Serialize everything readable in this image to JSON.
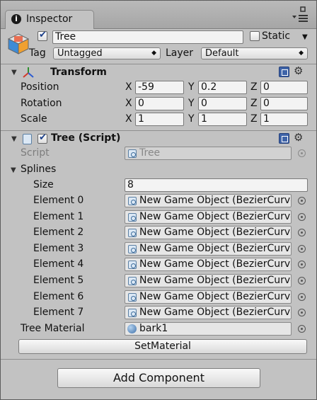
{
  "window": {
    "tab_label": "Inspector"
  },
  "gameobject": {
    "name": "Tree",
    "static_label": "Static",
    "tag_label": "Tag",
    "tag_value": "Untagged",
    "layer_label": "Layer",
    "layer_value": "Default"
  },
  "transform": {
    "title": "Transform",
    "axis_x": "X",
    "axis_y": "Y",
    "axis_z": "Z",
    "position": {
      "label": "Position",
      "x": "-59",
      "y": "0.2",
      "z": "0"
    },
    "rotation": {
      "label": "Rotation",
      "x": "0",
      "y": "0",
      "z": "0"
    },
    "scale": {
      "label": "Scale",
      "x": "1",
      "y": "1",
      "z": "1"
    }
  },
  "script_component": {
    "title": "Tree (Script)",
    "script_label": "Script",
    "script_value": "Tree",
    "splines_label": "Splines",
    "size_label": "Size",
    "size_value": "8",
    "elements": [
      {
        "label": "Element 0",
        "value": "New Game Object (BezierCurve)"
      },
      {
        "label": "Element 1",
        "value": "New Game Object (BezierCurve)"
      },
      {
        "label": "Element 2",
        "value": "New Game Object (BezierCurve)"
      },
      {
        "label": "Element 3",
        "value": "New Game Object (BezierCurve)"
      },
      {
        "label": "Element 4",
        "value": "New Game Object (BezierCurve)"
      },
      {
        "label": "Element 5",
        "value": "New Game Object (BezierCurve)"
      },
      {
        "label": "Element 6",
        "value": "New Game Object (BezierCurve)"
      },
      {
        "label": "Element 7",
        "value": "New Game Object (BezierCurve)"
      }
    ],
    "material_label": "Tree Material",
    "material_value": "bark1",
    "set_material_button": "SetMaterial"
  },
  "add_component_button": "Add Component"
}
